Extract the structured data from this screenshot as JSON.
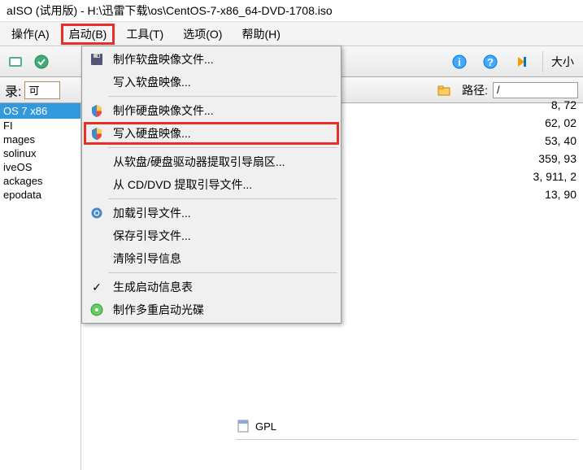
{
  "title": "aISO (试用版) - H:\\迅雷下载\\os\\CentOS-7-x86_64-DVD-1708.iso",
  "menubar": {
    "operate": "操作(A)",
    "boot": "启动(B)",
    "tools": "工具(T)",
    "options": "选项(O)",
    "help": "帮助(H)"
  },
  "toolbar": {
    "size_label": "大小"
  },
  "subbar": {
    "left_label": "录:",
    "left_value": "可",
    "path_label": "路径:",
    "path_value": "/"
  },
  "tree": {
    "root": "OS 7 x86",
    "items": [
      "FI",
      "mages",
      "solinux",
      "iveOS",
      "ackages",
      "epodata"
    ]
  },
  "dropdown": {
    "items": [
      {
        "icon": "floppy-icon",
        "label": "制作软盘映像文件...",
        "hl": false
      },
      {
        "icon": "",
        "label": "写入软盘映像...",
        "hl": false
      },
      {
        "sep": true
      },
      {
        "icon": "shield-icon",
        "label": "制作硬盘映像文件...",
        "hl": false
      },
      {
        "icon": "shield-icon",
        "label": "写入硬盘映像...",
        "hl": true
      },
      {
        "sep": true
      },
      {
        "icon": "",
        "label": "从软盘/硬盘驱动器提取引导扇区...",
        "hl": false
      },
      {
        "icon": "",
        "label": "从 CD/DVD 提取引导文件...",
        "hl": false
      },
      {
        "sep": true
      },
      {
        "icon": "gear-icon",
        "label": "加载引导文件...",
        "hl": false
      },
      {
        "icon": "",
        "label": "保存引导文件...",
        "hl": false
      },
      {
        "icon": "",
        "label": "清除引导信息",
        "hl": false
      },
      {
        "sep": true
      },
      {
        "icon": "check-icon",
        "label": "生成启动信息表",
        "hl": false
      },
      {
        "icon": "disc-icon",
        "label": "制作多重启动光碟",
        "hl": false
      }
    ]
  },
  "sizes": [
    "8, 72",
    "62, 02",
    "53, 40",
    "359, 93",
    "3, 911, 2",
    "13, 90"
  ],
  "bottom": {
    "label": "GPL"
  }
}
